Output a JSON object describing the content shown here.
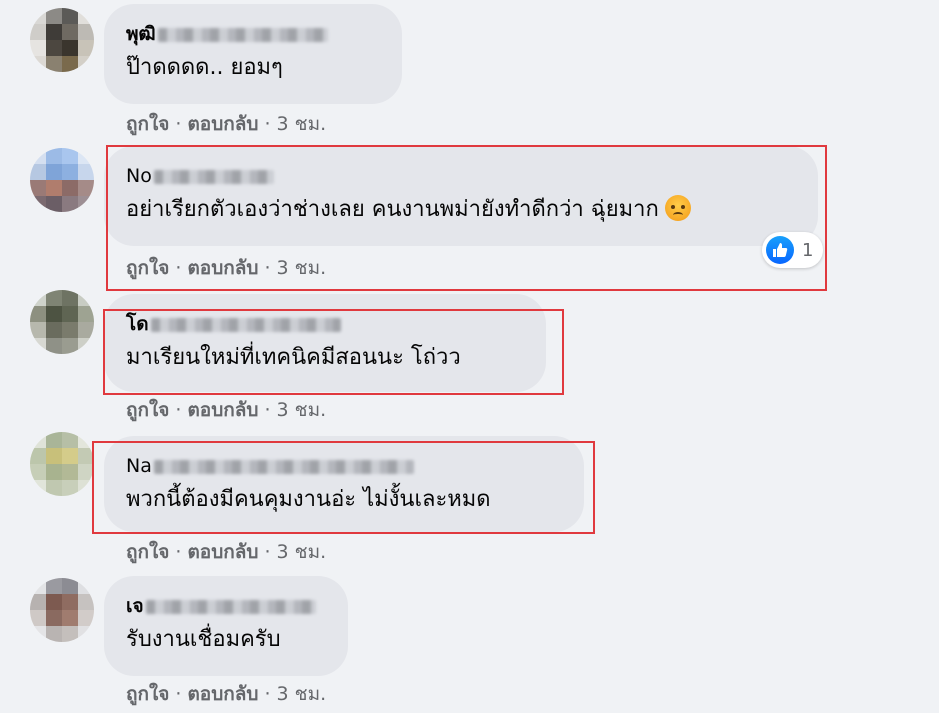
{
  "comments": [
    {
      "author": "พุฒิ",
      "text": "ป๊าดดดด.. ยอมๆ",
      "actions": {
        "like": "ถูกใจ",
        "reply": "ตอบกลับ",
        "time": "3 ชม."
      },
      "avatar_colors": [
        "#d9d8d5",
        "#8c8a86",
        "#5b5a57",
        "#e1dfdb",
        "#cfcdc9",
        "#3f3c38",
        "#6f6a62",
        "#bdbab4",
        "#e6e4e1",
        "#4c4740",
        "#3a352d",
        "#c8c3b8",
        "#dcd9d4",
        "#8a8170",
        "#7a6a4c",
        "#d3cfc7"
      ]
    },
    {
      "author": "No",
      "text": "อย่าเรียกตัวเองว่าช่างเลย คนงานพม่ายังทำดีกว่า ฉุ่ยมาก",
      "emoji": "angry-face",
      "reaction": {
        "icon": "like",
        "count": "1"
      },
      "actions": {
        "like": "ถูกใจ",
        "reply": "ตอบกลับ",
        "time": "3 ชม."
      },
      "avatar_colors": [
        "#d4dff0",
        "#9cbbe6",
        "#a9c6ee",
        "#dce6f4",
        "#b6c8e2",
        "#7fa4d8",
        "#8db0e0",
        "#c7d6ec",
        "#9a7a76",
        "#b07d6d",
        "#8c6b67",
        "#a58b88",
        "#7b6a70",
        "#6b5e66",
        "#8a7a80",
        "#9d8f94"
      ]
    },
    {
      "author": "โด",
      "text": "มาเรียนใหม่ที่เทคนิคมีสอนนะ โถ่วว",
      "actions": {
        "like": "ถูกใจ",
        "reply": "ตอบกลับ",
        "time": "3 ชม."
      },
      "avatar_colors": [
        "#cfd3cb",
        "#7f8474",
        "#6e7363",
        "#c8ccc3",
        "#8d9080",
        "#4d5342",
        "#5f6553",
        "#9ea392",
        "#b7b8ad",
        "#6a6c5e",
        "#7a7b6c",
        "#a9aa9f",
        "#d7d8d2",
        "#8f9187",
        "#9a9c90",
        "#cdcfc7"
      ]
    },
    {
      "author": "Na",
      "text": "พวกนี้ต้องมีคนคุมงานอ่ะ ไม่งั้นเละหมด",
      "actions": {
        "like": "ถูกใจ",
        "reply": "ตอบกลับ",
        "time": "3 ชม."
      },
      "avatar_colors": [
        "#dfe3d8",
        "#a9b598",
        "#b6bfa6",
        "#e3e6dc",
        "#bcc6ab",
        "#c8c07a",
        "#d4cc8a",
        "#c3cab4",
        "#c6ceb7",
        "#a8b38f",
        "#b2b996",
        "#cfd5c4",
        "#e1e5da",
        "#c0c8b0",
        "#c8cfba",
        "#dde1d5"
      ]
    },
    {
      "author": "เจ",
      "text": "รับงานเชื่อมครับ",
      "actions": {
        "like": "ถูกใจ",
        "reply": "ตอบกลับ",
        "time": "3 ชม."
      },
      "avatar_colors": [
        "#e3e4e6",
        "#9a9aa0",
        "#8c8c93",
        "#dedfe2",
        "#b7b2b0",
        "#7d5a50",
        "#8f6c61",
        "#c6c2c0",
        "#cfc9c6",
        "#8a6a60",
        "#a07c6f",
        "#d2ccc9",
        "#e4e4e6",
        "#b9b4b2",
        "#c4bfbc",
        "#e1e1e3"
      ]
    }
  ],
  "colors": {
    "page_bg": "#f0f2f5",
    "bubble_bg": "#e4e6eb",
    "highlight_box": "#e0393e",
    "meta_text": "#65676b",
    "like_blue": "#0866ff"
  }
}
